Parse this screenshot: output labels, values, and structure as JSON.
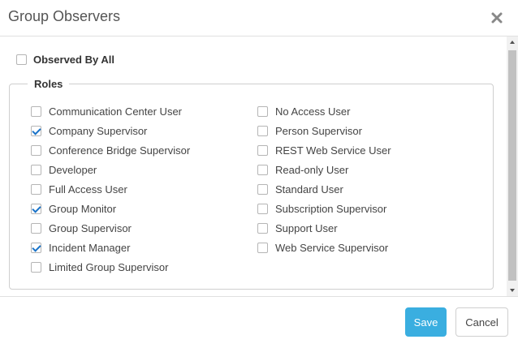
{
  "dialog": {
    "title": "Group Observers",
    "close_icon": "close-icon"
  },
  "observed_by_all": {
    "label": "Observed By All",
    "checked": false
  },
  "roles": {
    "legend": "Roles",
    "left_column": [
      {
        "label": "Communication Center User",
        "checked": false
      },
      {
        "label": "Company Supervisor",
        "checked": true
      },
      {
        "label": "Conference Bridge Supervisor",
        "checked": false
      },
      {
        "label": "Developer",
        "checked": false
      },
      {
        "label": "Full Access User",
        "checked": false
      },
      {
        "label": "Group Monitor",
        "checked": true
      },
      {
        "label": "Group Supervisor",
        "checked": false
      },
      {
        "label": "Incident Manager",
        "checked": true
      },
      {
        "label": "Limited Group Supervisor",
        "checked": false
      }
    ],
    "right_column": [
      {
        "label": "No Access User",
        "checked": false
      },
      {
        "label": "Person Supervisor",
        "checked": false
      },
      {
        "label": "REST Web Service User",
        "checked": false
      },
      {
        "label": "Read-only User",
        "checked": false
      },
      {
        "label": "Standard User",
        "checked": false
      },
      {
        "label": "Subscription Supervisor",
        "checked": false
      },
      {
        "label": "Support User",
        "checked": false
      },
      {
        "label": "Web Service Supervisor",
        "checked": false
      }
    ]
  },
  "footer": {
    "save_label": "Save",
    "cancel_label": "Cancel"
  },
  "colors": {
    "accent": "#3aaee0",
    "check": "#1a73c8"
  }
}
